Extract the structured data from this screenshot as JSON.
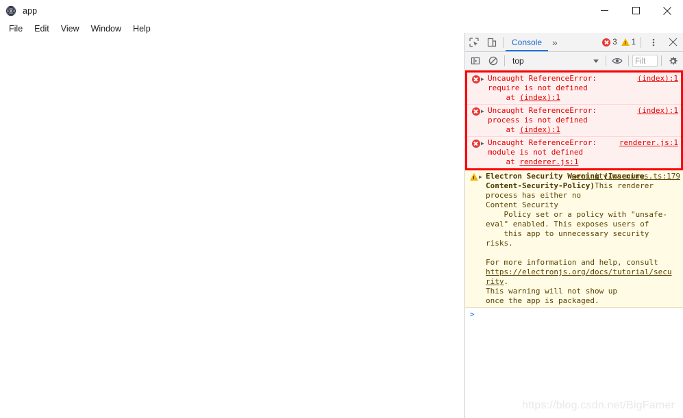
{
  "window": {
    "app_title": "app",
    "app_icon": "electron-logo-icon",
    "controls": {
      "minimize": "minimize-icon",
      "maximize": "maximize-icon",
      "close": "close-icon"
    }
  },
  "menubar": {
    "items": [
      {
        "label": "File"
      },
      {
        "label": "Edit"
      },
      {
        "label": "View"
      },
      {
        "label": "Window"
      },
      {
        "label": "Help"
      }
    ]
  },
  "devtools": {
    "tabbar": {
      "inspect_icon": "inspect-element-icon",
      "device_icon": "device-toolbar-icon",
      "tabs": [
        {
          "label": "Console",
          "active": true
        }
      ],
      "more_tabs": "»",
      "error_count": "3",
      "warning_count": "1",
      "menu_icon": "kebab-menu-icon",
      "close_icon": "close-icon"
    },
    "filterbar": {
      "sidebar_icon": "console-sidebar-icon",
      "clear_icon": "clear-console-icon",
      "context": "top",
      "eye_icon": "live-expression-eye-icon",
      "filter_placeholder": "Filt",
      "settings_icon": "settings-gear-icon"
    },
    "messages": [
      {
        "level": "error",
        "icon": "error-circle-icon",
        "expand_icon": "expand-triangle-icon",
        "text": "Uncaught ReferenceError:\nrequire is not defined\n    at ",
        "inline_link": "(index):1",
        "source": "(index):1"
      },
      {
        "level": "error",
        "icon": "error-circle-icon",
        "expand_icon": "expand-triangle-icon",
        "text": "Uncaught ReferenceError:\nprocess is not defined\n    at ",
        "inline_link": "(index):1",
        "source": "(index):1"
      },
      {
        "level": "error",
        "icon": "error-circle-icon",
        "expand_icon": "expand-triangle-icon",
        "text": "Uncaught ReferenceError:\nmodule is not defined\n    at ",
        "inline_link": "renderer.js:1",
        "source": "renderer.js:1"
      }
    ],
    "warning": {
      "level": "warning",
      "icon": "warning-triangle-icon",
      "expand_icon": "expand-triangle-icon",
      "source": "security-warnings.ts:179",
      "heading": "Electron Security Warning (Insecure\nContent-Security-Policy)",
      "body_before": "This renderer process has either no\nContent Security\n    Policy set or a policy with \"unsafe-\neval\" enabled. This exposes users of\n    this app to unnecessary security\nrisks.\n\nFor more information and help, consult\n",
      "link": "https://electronjs.org/docs/tutorial/secu\nrity",
      "body_after": ".\nThis warning will not show up\nonce the app is packaged."
    },
    "prompt": {
      "caret": ">",
      "value": ""
    }
  },
  "watermark": {
    "text": "https://blog.csdn.net/BigFamer"
  },
  "colors": {
    "error_text": "#e30000",
    "error_bg": "#fff0f0",
    "error_border": "#ff0000",
    "warning_text": "#5c4400",
    "warning_bg": "#fffbe5",
    "accent_tab": "#1a73e8",
    "prompt": "#4287f5"
  }
}
